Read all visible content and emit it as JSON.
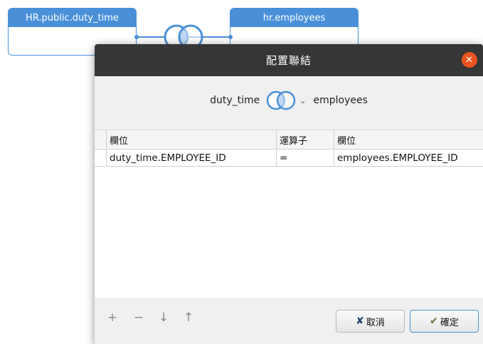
{
  "canvas": {
    "left_table": {
      "title": "HR.public.duty_time"
    },
    "right_table": {
      "title": "hr.employees"
    }
  },
  "dialog": {
    "title": "配置聯結",
    "join": {
      "left_table": "duty_time",
      "right_table": "employees",
      "type_icon": "full-outer-join-venn-icon"
    },
    "grid": {
      "headers": [
        "欄位",
        "運算子",
        "欄位"
      ],
      "rows": [
        {
          "left_field": "duty_time.EMPLOYEE_ID",
          "operator": "=",
          "right_field": "employees.EMPLOYEE_ID"
        }
      ]
    },
    "toolbar": {
      "add": "+",
      "remove": "−",
      "move_down": "↓",
      "move_up": "↑"
    },
    "buttons": {
      "cancel": "取消",
      "ok": "確定"
    }
  },
  "colors": {
    "accent": "#4a90d9",
    "titlebar": "#363636",
    "close": "#e95420",
    "cancel_icon": "#1f3b6e",
    "ok_icon": "#5b7a3a"
  }
}
